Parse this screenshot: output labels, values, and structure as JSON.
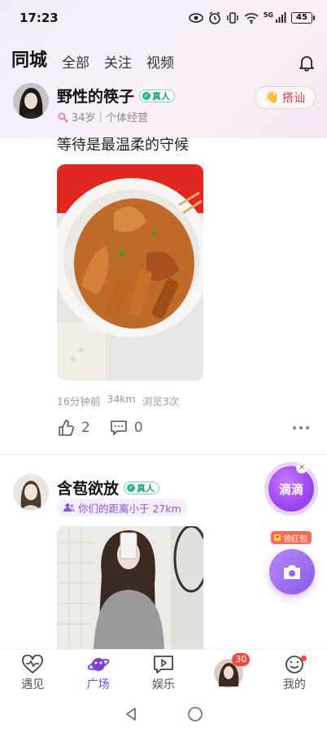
{
  "status": {
    "time": "17:23",
    "battery": "45",
    "network": "5G"
  },
  "tabs": [
    {
      "label": "同城",
      "active": true
    },
    {
      "label": "全部",
      "active": false
    },
    {
      "label": "关注",
      "active": false
    },
    {
      "label": "视频",
      "active": false
    }
  ],
  "posts": [
    {
      "username": "野性的筷子",
      "verified_label": "真人",
      "age": "34岁",
      "occupation": "个体经营",
      "greet_label": "搭讪",
      "text": "等待是最温柔的守候",
      "time_ago": "16分钟前",
      "distance": "34km",
      "views": "浏览3次",
      "likes": "2",
      "comments": "0"
    },
    {
      "username": "含苞欲放",
      "verified_label": "真人",
      "distance_tag": "你们的距离小于 27km"
    }
  ],
  "floating": {
    "didi_label": "滴滴",
    "close": "×",
    "hongbao_label": "领红包"
  },
  "bottom_nav": [
    {
      "label": "遇见",
      "icon": "heart-pulse-icon"
    },
    {
      "label": "广场",
      "icon": "planet-icon",
      "active": true
    },
    {
      "label": "娱乐",
      "icon": "play-chat-icon"
    },
    {
      "label": "",
      "icon": "avatar-icon",
      "badge": "30"
    },
    {
      "label": "我的",
      "icon": "smile-icon",
      "dot": true
    }
  ],
  "colors": {
    "accent": "#7b3fe0",
    "verified": "#2bb38f",
    "greet": "#d23a4e"
  }
}
